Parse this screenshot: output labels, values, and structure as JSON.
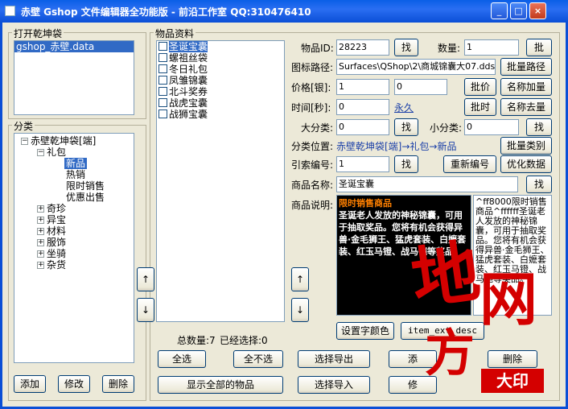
{
  "window": {
    "title": "赤壁 Gshop 文件编辑器全功能版 - 前沿工作室 QQ:310476410",
    "min": "_",
    "max": "□",
    "close": "×"
  },
  "open_group": {
    "label": "打开乾坤袋",
    "files": [
      "gshop_赤壁.data"
    ]
  },
  "category_group": {
    "label": "分类",
    "tree": [
      {
        "label": "赤壁乾坤袋[端]",
        "expander": "−"
      },
      {
        "label": "礼包",
        "expander": "−"
      },
      {
        "label": "新品"
      },
      {
        "label": "热销"
      },
      {
        "label": "限时销售"
      },
      {
        "label": "优惠出售"
      },
      {
        "label": "奇珍",
        "expander": "+"
      },
      {
        "label": "异宝",
        "expander": "+"
      },
      {
        "label": "材料",
        "expander": "+"
      },
      {
        "label": "服饰",
        "expander": "+"
      },
      {
        "label": "坐骑",
        "expander": "+"
      },
      {
        "label": "杂货",
        "expander": "+"
      }
    ],
    "buttons": {
      "add": "添加",
      "edit": "修改",
      "delete": "删除"
    }
  },
  "items_group": {
    "label": "物品资料",
    "items": [
      "圣诞宝囊",
      "螺祖丝袋",
      "冬日礼包",
      "凤雏锦囊",
      "北斗奖券",
      "战虎宝囊",
      "战狮宝囊"
    ],
    "up_arrow": "↑",
    "down_arrow": "↓",
    "total": "总数量:7",
    "selected": "已经选择:0",
    "buttons": {
      "select_all": "全选",
      "select_none": "全不选",
      "export_selected": "选择导出",
      "add": "添",
      "delete": "删除",
      "show_all": "显示全部的物品",
      "import_selected": "选择导入",
      "edit": "修"
    }
  },
  "detail": {
    "id_label": "物品ID:",
    "id_value": "28223",
    "find": "找",
    "qty_label": "数量:",
    "qty_value": "1",
    "batch": "批",
    "icon_label": "图标路径:",
    "icon_value": "Surfaces\\QShop\\2\\商城锦囊大07.dds",
    "batch_icon": "批量路径",
    "price_label": "价格[银]:",
    "price_value": "1",
    "price_value2": "0",
    "batch_price": "批价",
    "name_add": "名称加量",
    "time_label": "时间[秒]:",
    "time_value": "0",
    "time_text": "永久",
    "batch_time": "批时",
    "name_remove": "名称去量",
    "major_label": "大分类:",
    "major_value": "0",
    "minor_label": "小分类:",
    "minor_value": "0",
    "location_label": "分类位置:",
    "location_value": "赤壁乾坤袋[端]→礼包→新品",
    "batch_category": "批量类别",
    "index_label": "引索编号:",
    "index_value": "1",
    "renumber": "重新编号",
    "optimize": "优化数据",
    "name_label": "商品名称:",
    "name_value": "圣诞宝囊",
    "desc_label": "商品说明:",
    "desc_title": "限时销售商品",
    "desc_body": "圣诞老人发放的神秘锦囊，可用于抽取奖品。您将有机会获得异兽·金毛狮王、猛虎套装、白嬷套装、红玉马镫、战马铠等奖品。",
    "desc_raw": "^ff8000限时销售商品^ffffff圣诞老人发放的神秘锦囊，可用于抽取奖品。您将有机会获得异兽·金毛狮王、猛虎套装、白嬷套装、红玉马镫、战马铠等奖品。",
    "set_color": "设置字颜色",
    "ext_desc": "item_ext_desc"
  },
  "watermark": {
    "line1": "地",
    "line2": "网",
    "line3": "方",
    "seal": "大印"
  },
  "colors": {
    "title_bar": "#0b4fd6",
    "selection": "#316ac5",
    "desc_title": "#ff8000",
    "watermark": "#d40000"
  }
}
